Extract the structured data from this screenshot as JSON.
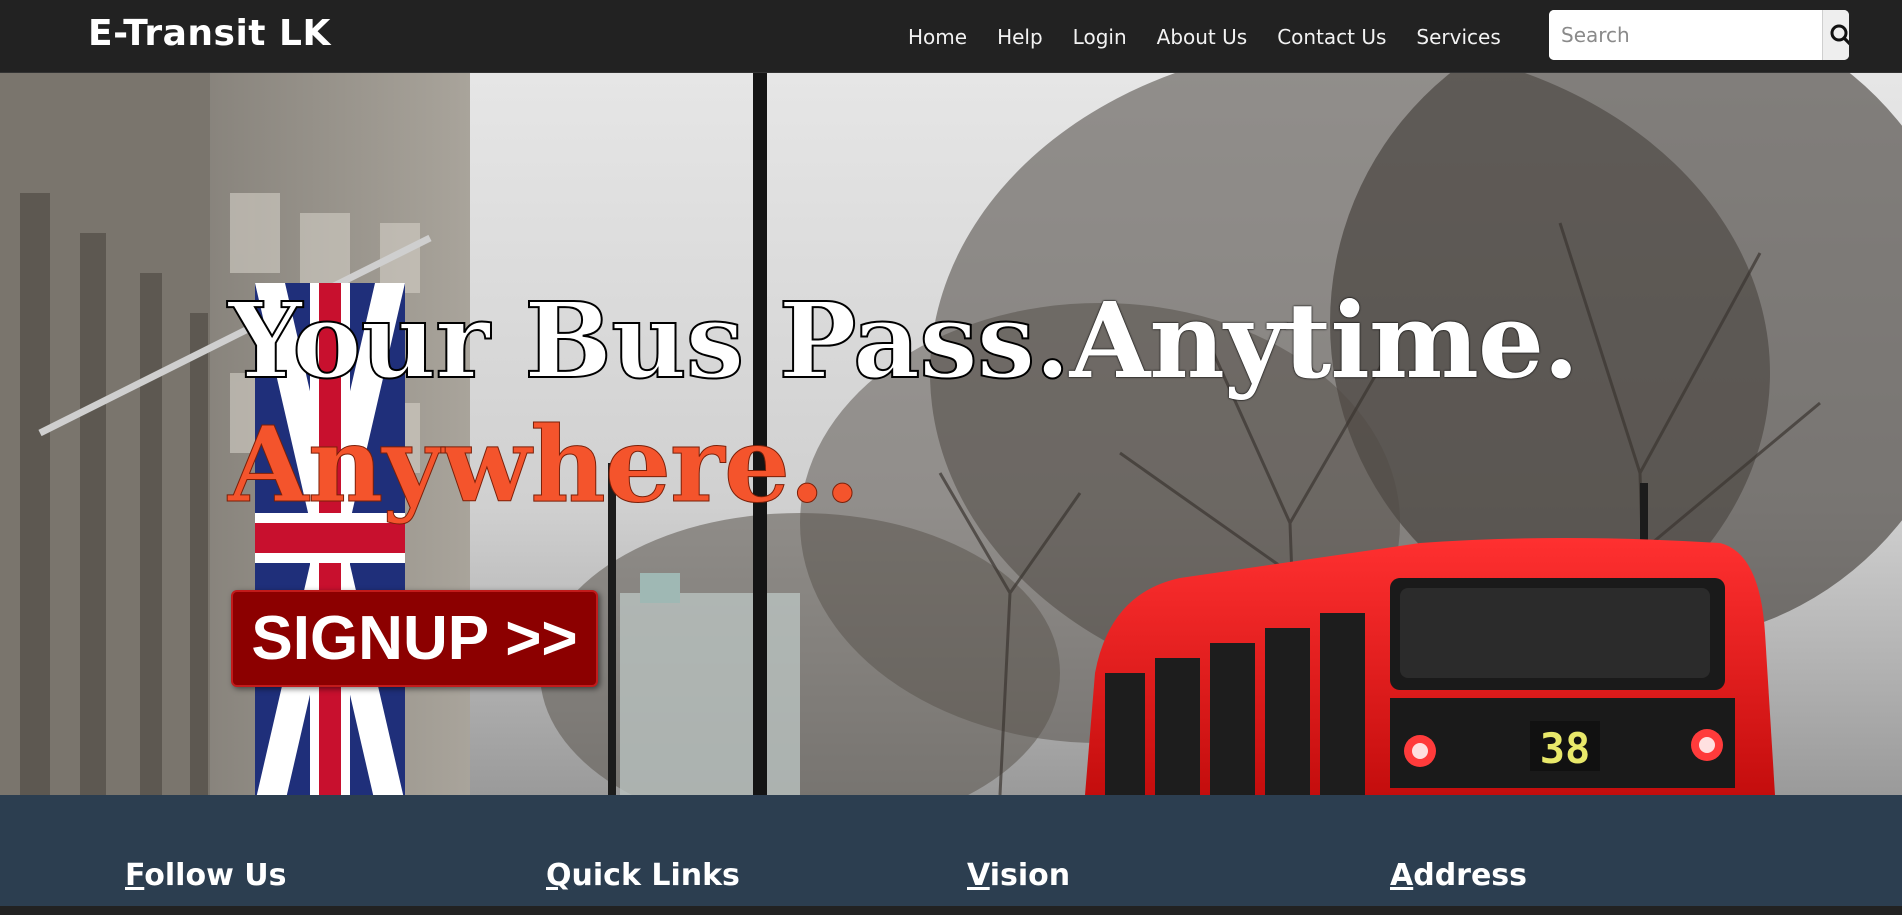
{
  "brand": "E-Transit LK",
  "nav": {
    "links": [
      "Home",
      "Help",
      "Login",
      "About Us",
      "Contact Us",
      "Services"
    ]
  },
  "search": {
    "placeholder": "Search",
    "value": "",
    "icon": "search-icon"
  },
  "hero": {
    "title_part1": "Your Bus Pass.",
    "title_part2": "Anytime.",
    "subtitle": "Anywhere..",
    "signup_label": "SIGNUP >>",
    "bus_route_number": "38"
  },
  "footer": {
    "headings": [
      "Follow Us",
      "Quick Links",
      "Vision",
      "Address"
    ]
  },
  "colors": {
    "navbar_bg": "#222222",
    "footer_bg": "#2c3e50",
    "accent_orange": "#f4542c",
    "signup_bg": "#8c0000",
    "bus_red": "#e31b1b"
  }
}
